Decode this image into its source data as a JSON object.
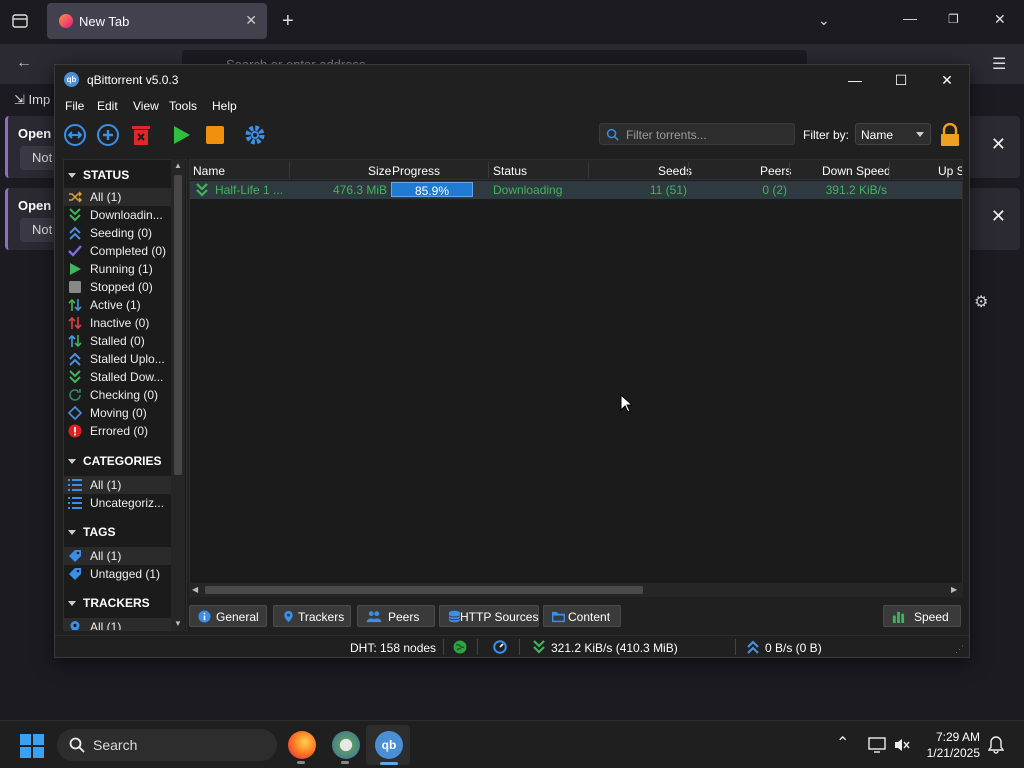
{
  "browser": {
    "tab_title": "New Tab",
    "url_placeholder": "Search or enter address",
    "bookmark_label": "Imp",
    "cards": [
      {
        "title": "Open I",
        "button": "Not"
      },
      {
        "title": "Open I",
        "button": "Not"
      }
    ]
  },
  "window": {
    "title": "qBittorrent v5.0.3",
    "menu": [
      "File",
      "Edit",
      "View",
      "Tools",
      "Help"
    ]
  },
  "toolbar": {
    "filter_placeholder": "Filter torrents...",
    "filter_by_label": "Filter by:",
    "filter_by_value": "Name"
  },
  "sidebar": {
    "status_title": "STATUS",
    "status_items": [
      {
        "label": "All (1)",
        "icon": "shuffle-icon",
        "color": "#e0a030"
      },
      {
        "label": "Downloadin...",
        "icon": "double-chevron-down-icon",
        "color": "#3fb55a"
      },
      {
        "label": "Seeding (0)",
        "icon": "double-chevron-up-icon",
        "color": "#4a8fe0"
      },
      {
        "label": "Completed (0)",
        "icon": "checkmark-icon",
        "color": "#7a6ee0"
      },
      {
        "label": "Running (1)",
        "icon": "play-icon",
        "color": "#3fb55a"
      },
      {
        "label": "Stopped (0)",
        "icon": "stop-square-icon",
        "color": "#888888"
      },
      {
        "label": "Active (1)",
        "icon": "up-down-arrows-icon",
        "color": "#3fb55a"
      },
      {
        "label": "Inactive (0)",
        "icon": "up-down-arrows-red-icon",
        "color": "#e04040"
      },
      {
        "label": "Stalled (0)",
        "icon": "up-down-arrows-stalled-icon",
        "color": "#40a0e0"
      },
      {
        "label": "Stalled Uplo...",
        "icon": "double-chevron-up-icon",
        "color": "#4a8fe0"
      },
      {
        "label": "Stalled Dow...",
        "icon": "double-chevron-down-icon",
        "color": "#3fb55a"
      },
      {
        "label": "Checking (0)",
        "icon": "refresh-icon",
        "color": "#2a8a6a"
      },
      {
        "label": "Moving (0)",
        "icon": "diamond-move-icon",
        "color": "#4a8fe0"
      },
      {
        "label": "Errored (0)",
        "icon": "error-icon",
        "color": "#e02020"
      }
    ],
    "categories_title": "CATEGORIES",
    "category_items": [
      {
        "label": "All (1)",
        "icon": "list-icon"
      },
      {
        "label": "Uncategoriz...",
        "icon": "list-icon"
      }
    ],
    "tags_title": "TAGS",
    "tag_items": [
      {
        "label": "All (1)",
        "icon": "tag-icon"
      },
      {
        "label": "Untagged (1)",
        "icon": "tag-icon"
      }
    ],
    "trackers_title": "TRACKERS",
    "tracker_items": [
      {
        "label": "All (1)",
        "icon": "location-pin-icon"
      }
    ]
  },
  "list": {
    "columns": [
      "Name",
      "Size",
      "Progress",
      "Status",
      "Seeds",
      "Peers",
      "Down Speed",
      "Up S"
    ],
    "rows": [
      {
        "name": "Half-Life 1 ...",
        "size": "476.3 MiB",
        "progress_text": "85.9%",
        "progress": 0.859,
        "status": "Downloading",
        "seeds": "11 (51)",
        "peers": "0 (2)",
        "down_speed": "391.2 KiB/s"
      }
    ]
  },
  "bottom_tabs": [
    "General",
    "Trackers",
    "Peers",
    "HTTP Sources",
    "Content"
  ],
  "speed_button": "Speed",
  "statusbar": {
    "dht": "DHT: 158 nodes",
    "down": "321.2 KiB/s (410.3 MiB)",
    "up": "0 B/s (0 B)"
  },
  "taskbar": {
    "search_label": "Search",
    "time": "7:29 AM",
    "date": "1/21/2025"
  }
}
